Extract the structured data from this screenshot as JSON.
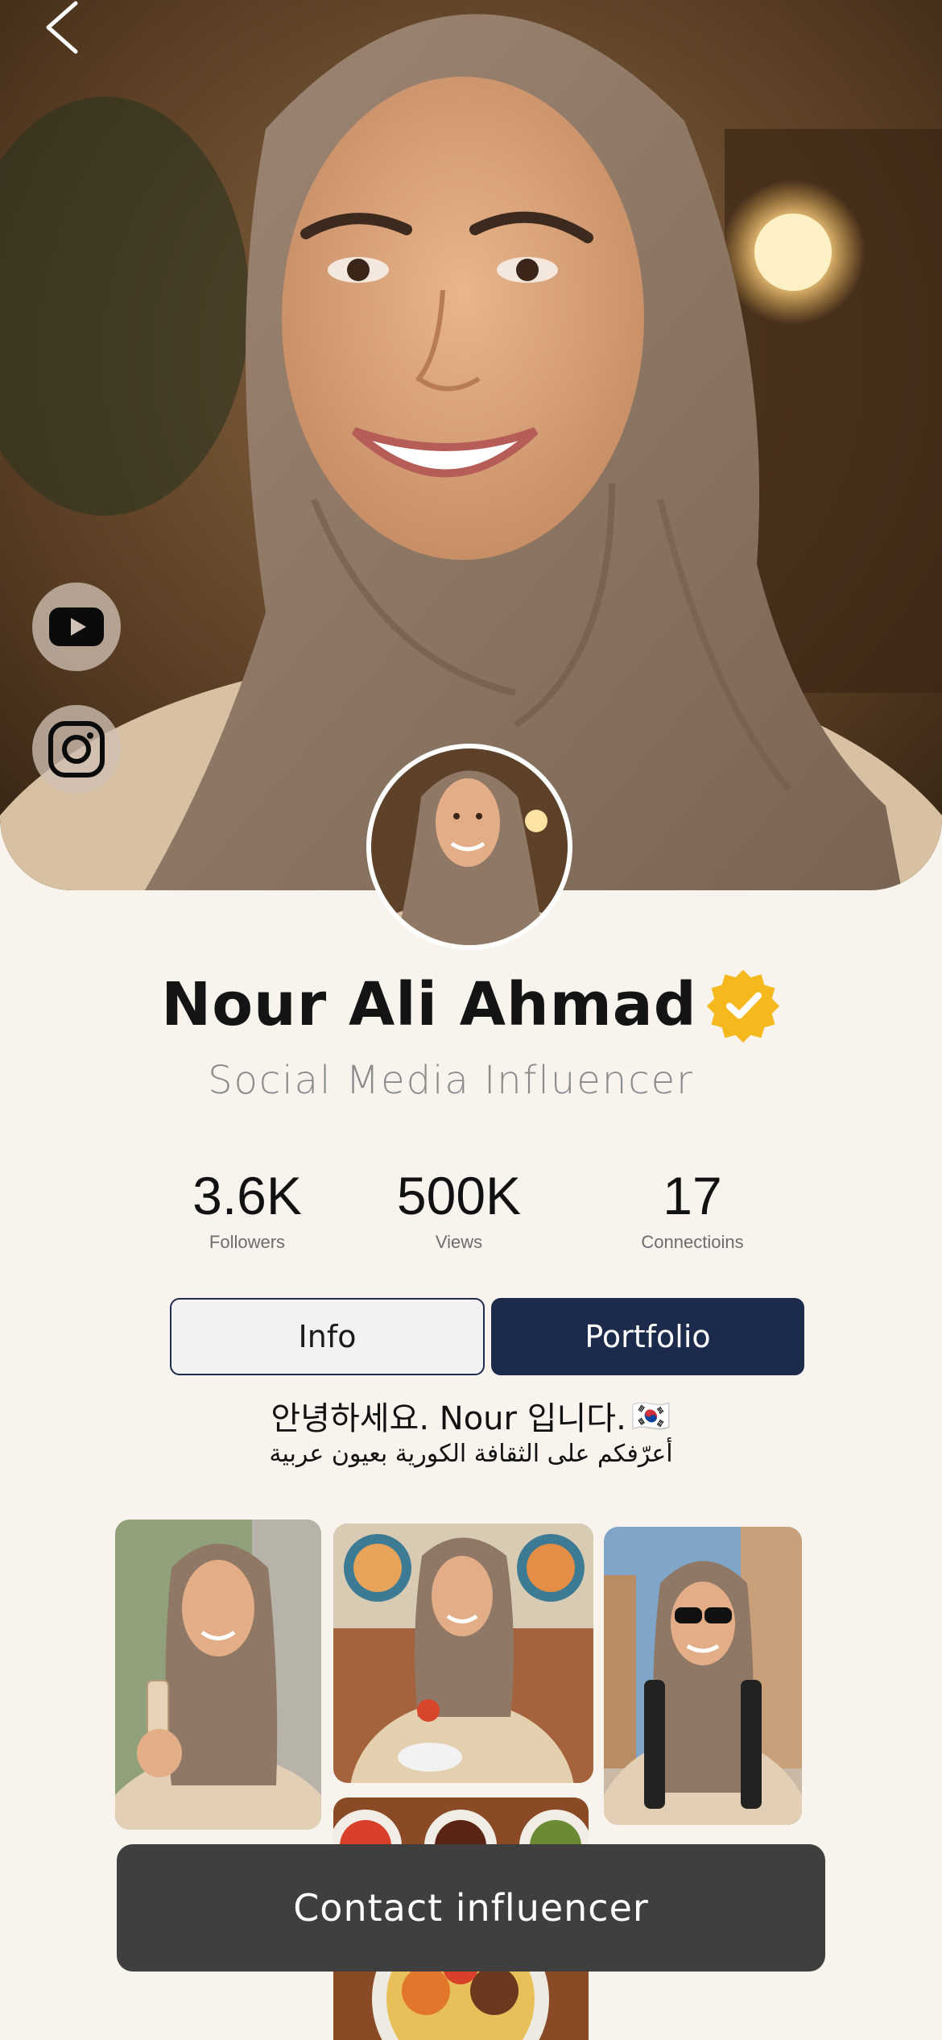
{
  "header": {
    "back_icon": "chevron-left-icon"
  },
  "social": {
    "youtube_icon": "youtube-icon",
    "instagram_icon": "instagram-icon"
  },
  "profile": {
    "name": "Nour Ali Ahmad",
    "role": "Social Media Influencer",
    "verified_icon": "verified-badge-icon",
    "verified_color": "#F5B91E"
  },
  "stats": [
    {
      "value": "3.6K",
      "label": "Followers"
    },
    {
      "value": "500K",
      "label": "Views"
    },
    {
      "value": "17",
      "label": "Connectioins"
    }
  ],
  "tabs": {
    "info": "Info",
    "portfolio": "Portfolio",
    "active": "Portfolio",
    "active_color": "#1C2A4C"
  },
  "bio": {
    "korean": "안녕하세요. Nour 입니다.",
    "flag": "🇰🇷",
    "arabic": "أعرّفكم على الثقافة الكورية بعيون عربية"
  },
  "cta": {
    "label": "Contact influencer"
  }
}
